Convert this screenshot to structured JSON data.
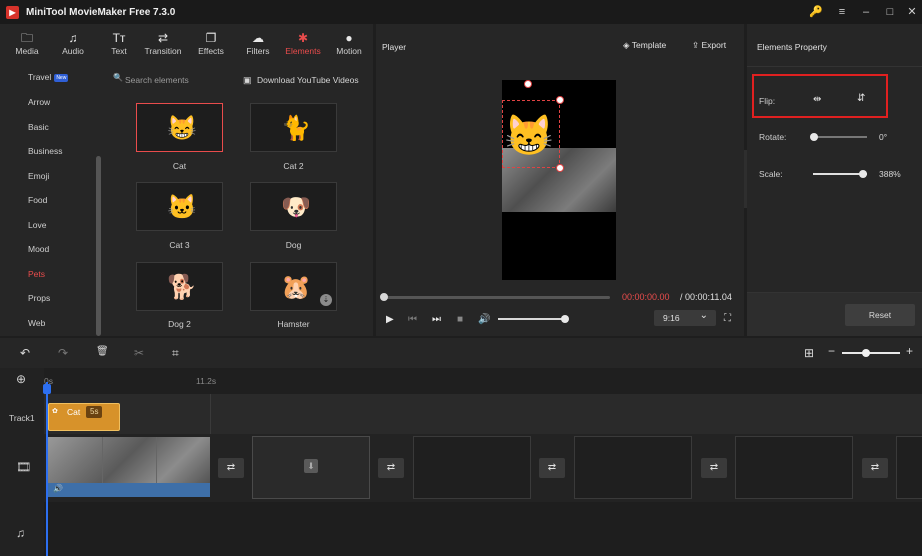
{
  "app": {
    "title": "MiniTool MovieMaker Free 7.3.0",
    "logo_glyph": "▶"
  },
  "window_controls": {
    "key": "🔑",
    "menu": "≡",
    "minimize": "–",
    "maximize": "□",
    "close": "✕"
  },
  "toolbar": {
    "tabs": [
      {
        "label": "Media",
        "icon": "🗀"
      },
      {
        "label": "Audio",
        "icon": "♫"
      },
      {
        "label": "Text",
        "icon": "Tт"
      },
      {
        "label": "Transition",
        "icon": "⇄"
      },
      {
        "label": "Effects",
        "icon": "❐"
      },
      {
        "label": "Filters",
        "icon": "☁"
      },
      {
        "label": "Elements",
        "icon": "✱"
      },
      {
        "label": "Motion",
        "icon": "●"
      }
    ],
    "active": "Elements"
  },
  "categories": {
    "items": [
      "Travel",
      "Arrow",
      "Basic",
      "Business",
      "Emoji",
      "Food",
      "Love",
      "Mood",
      "Pets",
      "Props",
      "Web"
    ],
    "active": "Pets",
    "new_badge": "New"
  },
  "elements_panel": {
    "search_placeholder": "Search elements",
    "search_icon": "🔍",
    "download_label": "Download YouTube Videos",
    "download_icon": "▣",
    "tiles": [
      {
        "label": "Cat",
        "emoji": "😸"
      },
      {
        "label": "Cat 2",
        "emoji": "🐈"
      },
      {
        "label": "Cat 3",
        "emoji": "🐱"
      },
      {
        "label": "Dog",
        "emoji": "🐶"
      },
      {
        "label": "Dog 2",
        "emoji": "🐕"
      },
      {
        "label": "Hamster",
        "emoji": "🐹"
      }
    ],
    "download_badge": "⇣"
  },
  "player": {
    "title": "Player",
    "template_label": "Template",
    "export_label": "Export",
    "template_icon": "◈",
    "export_icon": "⇪",
    "overlay_emoji": "😸",
    "time_current": "00:00:00.00",
    "time_total": "/ 00:00:11.04",
    "ratio": "9:16",
    "ratio_chevron": "⌄",
    "controls": {
      "play": "▶",
      "prev": "⏮",
      "next": "⏭",
      "stop": "■",
      "volume": "🔊",
      "fullscreen": "⛶"
    }
  },
  "properties": {
    "title": "Elements Property",
    "flip_label": "Flip:",
    "flip_h_icon": "⇹",
    "flip_v_icon": "⇵",
    "rotate_label": "Rotate:",
    "rotate_value": "0°",
    "scale_label": "Scale:",
    "scale_value": "388%",
    "reset_label": "Reset",
    "collapse_icon": "›"
  },
  "timeline": {
    "tools": {
      "undo": "↶",
      "redo": "↷",
      "delete": "🗑",
      "split": "✂",
      "crop": "⌗"
    },
    "fit_icon": "⊞",
    "zoom_out": "−",
    "zoom_in": "+",
    "ruler": [
      "0s",
      "11.2s"
    ],
    "track1_label": "Track1",
    "clip": {
      "label": "Cat",
      "duration": "5s"
    },
    "clip_icon": "✿",
    "transition_icon": "⇄",
    "add_track_icon": "⊕",
    "video_track_icon": "🎞",
    "audio_track_icon": "♫",
    "volume_icon": "🔊",
    "slot_icon": "⬇"
  }
}
